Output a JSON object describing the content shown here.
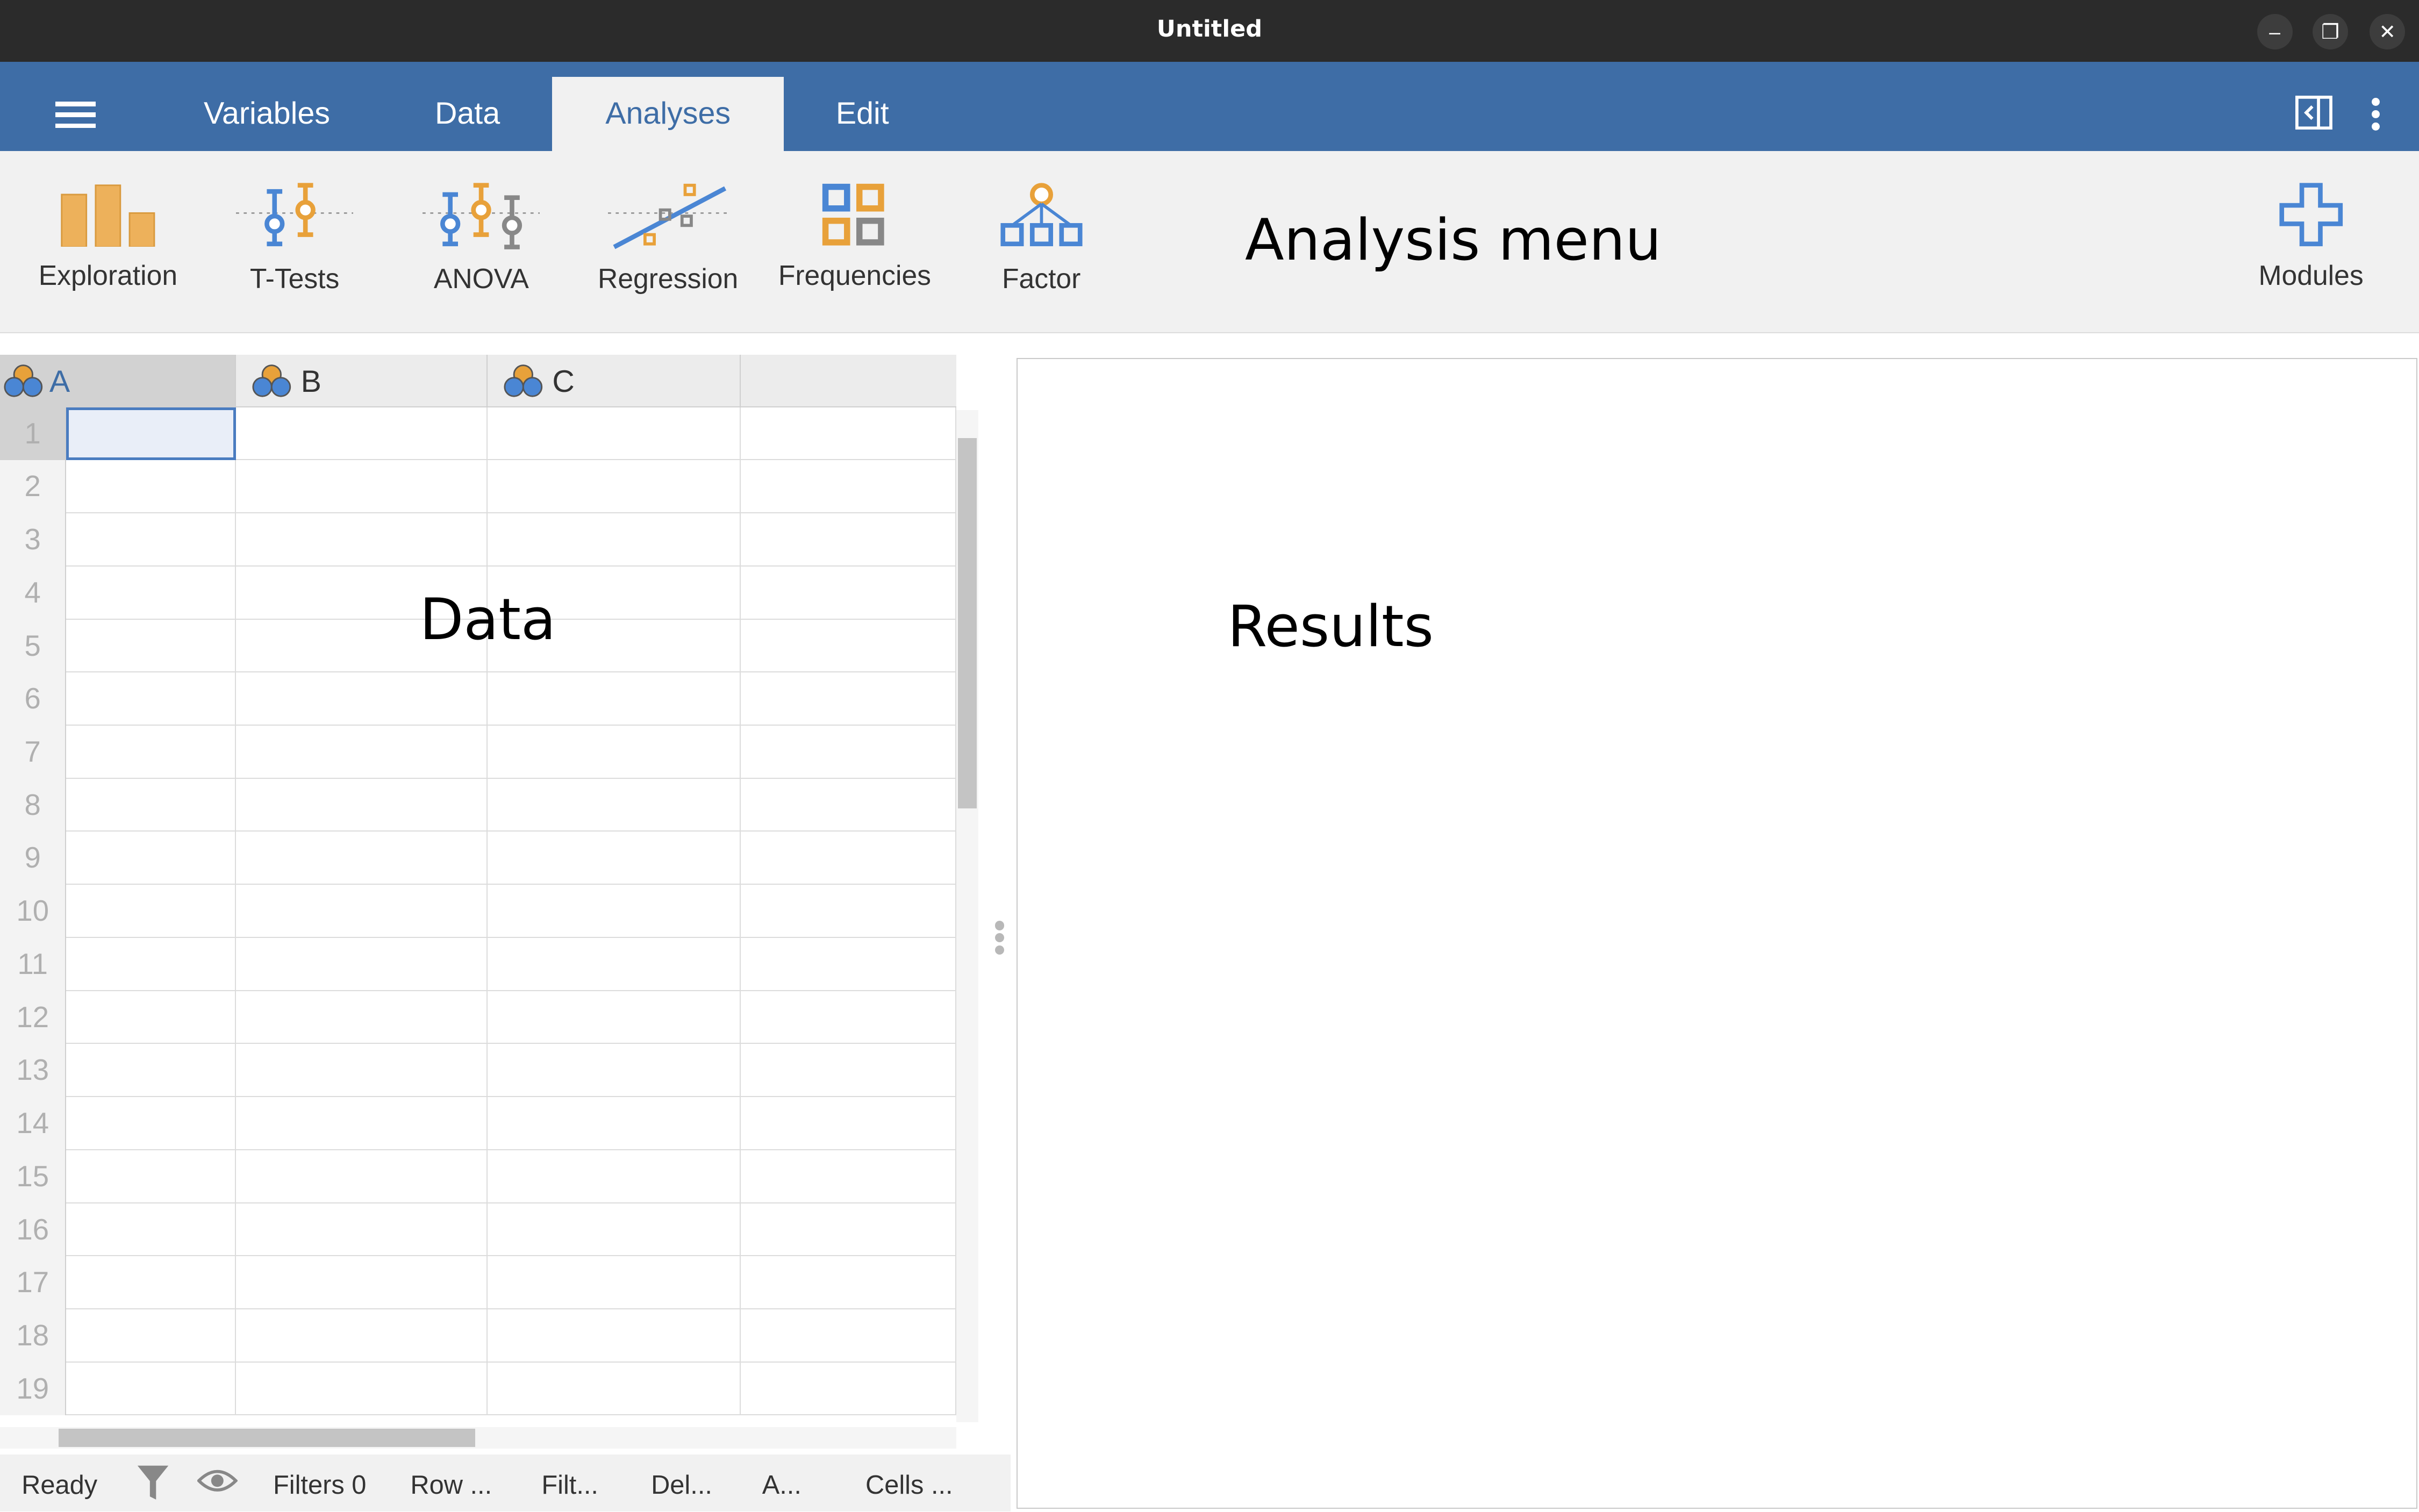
{
  "window": {
    "title": "Untitled"
  },
  "tabs": [
    {
      "label": "Variables"
    },
    {
      "label": "Data"
    },
    {
      "label": "Analyses",
      "active": true
    },
    {
      "label": "Edit"
    }
  ],
  "toolbar": {
    "items": [
      {
        "label": "Exploration",
        "icon": "bar-chart-icon"
      },
      {
        "label": "T-Tests",
        "icon": "t-tests-icon"
      },
      {
        "label": "ANOVA",
        "icon": "anova-icon"
      },
      {
        "label": "Regression",
        "icon": "regression-icon"
      },
      {
        "label": "Frequencies",
        "icon": "frequencies-icon"
      },
      {
        "label": "Factor",
        "icon": "factor-icon"
      }
    ],
    "modules_label": "Modules",
    "annotation": "Analysis menu"
  },
  "spreadsheet": {
    "columns": [
      "A",
      "B",
      "C"
    ],
    "rows": [
      "1",
      "2",
      "3",
      "4",
      "5",
      "6",
      "7",
      "8",
      "9",
      "10",
      "11",
      "12",
      "13",
      "14",
      "15",
      "16",
      "17",
      "18",
      "19"
    ],
    "annotation": "Data"
  },
  "results": {
    "annotation": "Results"
  },
  "status": {
    "ready": "Ready",
    "filters": "Filters 0",
    "row": "Row ...",
    "filt": "Filt...",
    "del": "Del...",
    "a": "A...",
    "cells": "Cells ..."
  },
  "colors": {
    "accent": "#3e6da6",
    "orange": "#e8a13a",
    "blue": "#4a86d4"
  }
}
